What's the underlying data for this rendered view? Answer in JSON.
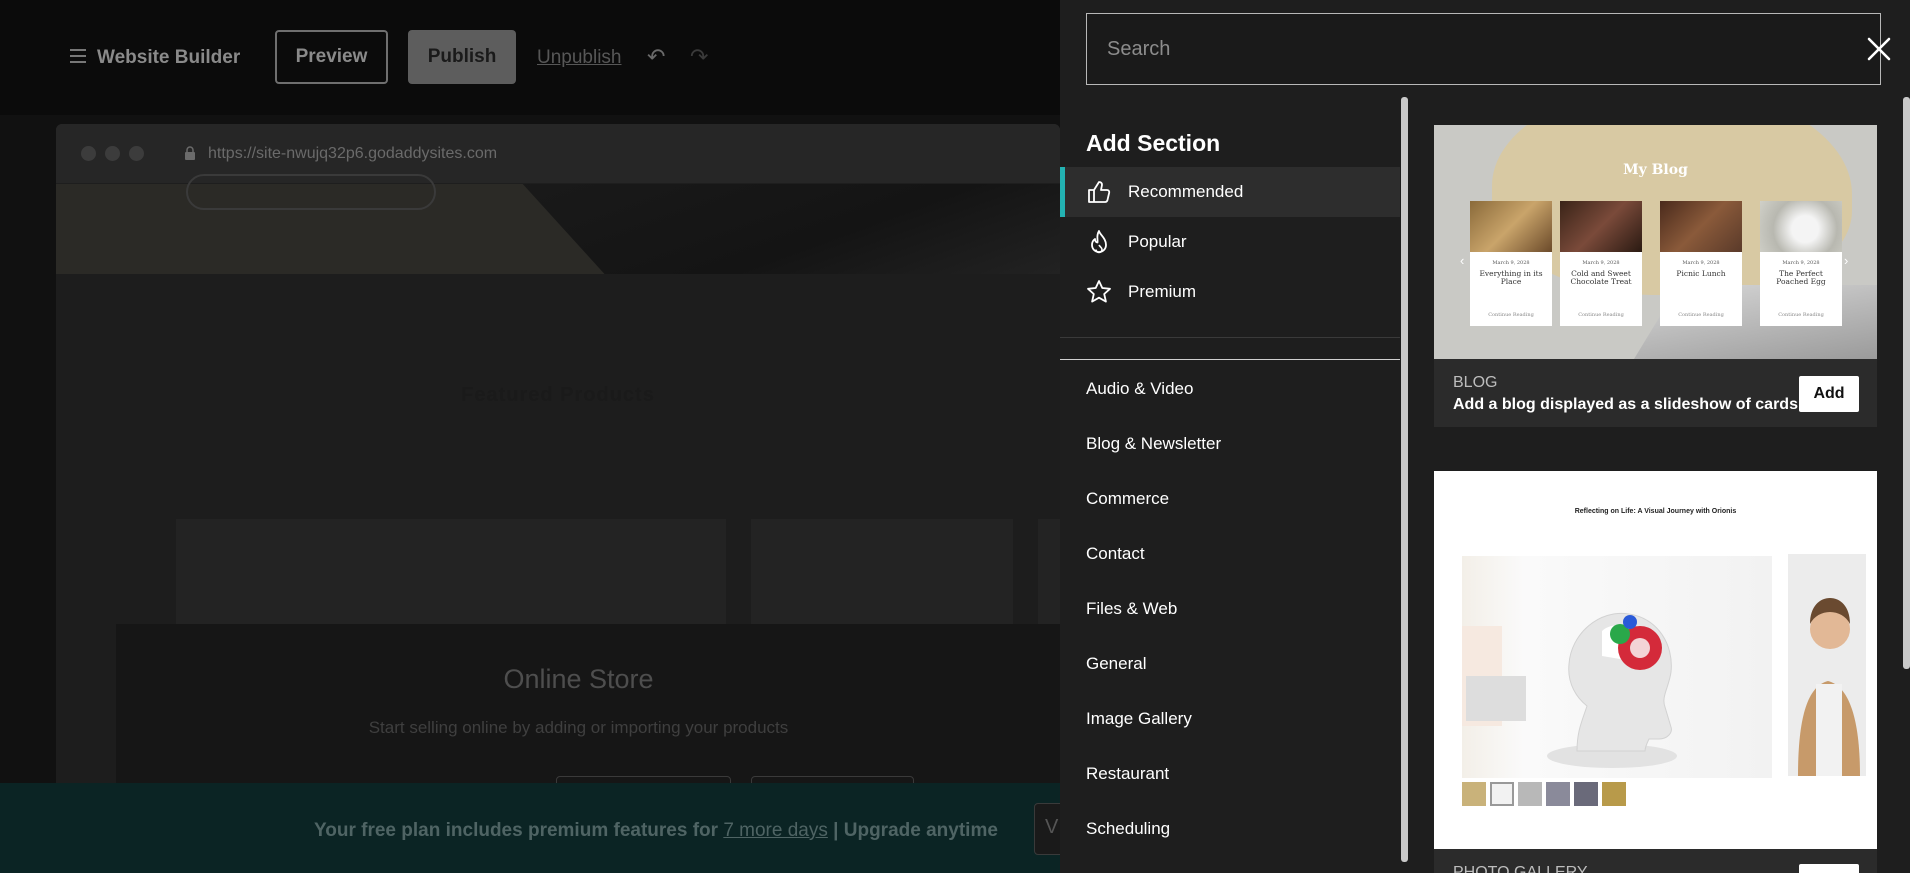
{
  "builder": {
    "title": "Website Builder",
    "preview_label": "Preview",
    "publish_label": "Publish",
    "unpublish_label": "Unpublish",
    "browser_url": "https://site-nwujq32p6.godaddysites.com",
    "featured_title": "Featured Products",
    "store_title": "Online Store",
    "store_subtitle": "Start selling online by adding or importing your products",
    "plan_text_prefix": "Your free plan includes premium features for",
    "plan_text_link": "7 more days",
    "plan_text_separator": "|",
    "plan_text_suffix": "Upgrade anytime",
    "plan_cta_partial": "V"
  },
  "panel": {
    "search_placeholder": "Search",
    "heading": "Add Section",
    "filters": [
      {
        "label": "Recommended",
        "icon": "thumbs-up-icon",
        "active": true
      },
      {
        "label": "Popular",
        "icon": "flame-icon",
        "active": false
      },
      {
        "label": "Premium",
        "icon": "star-icon",
        "active": false
      }
    ],
    "categories": [
      "Audio & Video",
      "Blog & Newsletter",
      "Commerce",
      "Contact",
      "Files & Web",
      "General",
      "Image Gallery",
      "Restaurant",
      "Scheduling"
    ],
    "accent_color": "#23b2b2"
  },
  "cards": [
    {
      "type": "BLOG",
      "description": "Add a blog displayed as a slideshow of cards",
      "add_label": "Add",
      "thumb": {
        "title": "My Blog",
        "posts": [
          {
            "date": "March 9, 2028",
            "title": "Everything in its Place",
            "cta": "Continue Reading"
          },
          {
            "date": "March 9, 2028",
            "title": "Cold and Sweet Chocolate Treat",
            "cta": "Continue Reading"
          },
          {
            "date": "March 9, 2028",
            "title": "Picnic Lunch",
            "cta": "Continue Reading"
          },
          {
            "date": "March 9, 2028",
            "title": "The Perfect Poached Egg",
            "cta": "Continue Reading"
          }
        ]
      }
    },
    {
      "type": "PHOTO GALLERY",
      "description": "",
      "add_label": "",
      "thumb": {
        "title": "Reflecting on Life: A Visual Journey with Orionis"
      }
    }
  ]
}
